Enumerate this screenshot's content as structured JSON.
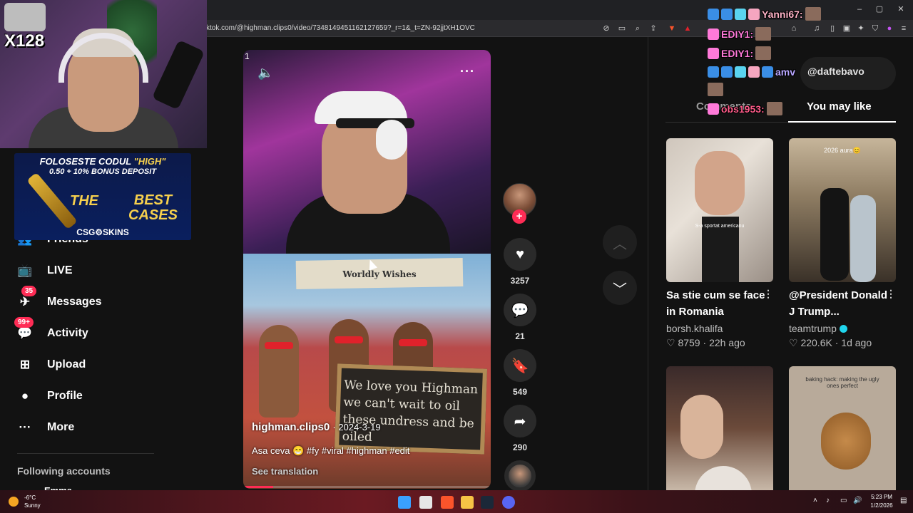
{
  "browser": {
    "url": "ktok.com/@highman.clips0/video/7348149451162127659?_r=1&_t=ZN-92jjtXH1OVC",
    "window_controls": [
      "–",
      "▢",
      "✕"
    ]
  },
  "stream_overlay": {
    "x_count": "X128",
    "chat": [
      {
        "user": "Yanni67:",
        "color": "#ffb3c7"
      },
      {
        "user": "EDIY1:",
        "color": "#ff7ad9"
      },
      {
        "user": "EDIY1:",
        "color": "#ff7ad9"
      },
      {
        "user": "amv",
        "color": "#b8a6ff"
      },
      {
        "user": "obs1953:",
        "color": "#ff5c8a"
      }
    ]
  },
  "ad": {
    "line1_prefix": "FOLOSESTE CODUL ",
    "line1_code": "\"HIGH\"",
    "line2": "0.50 + 10% BONUS DEPOSIT",
    "the": "THE",
    "best": "BEST",
    "cases": "CASES",
    "logo": "CSG⚙SKINS"
  },
  "sidebar": {
    "items": [
      {
        "label": "Friends",
        "icon": "friends-icon",
        "glyph": "👥"
      },
      {
        "label": "LIVE",
        "icon": "live-icon",
        "glyph": "📺"
      },
      {
        "label": "Messages",
        "icon": "messages-icon",
        "glyph": "✈",
        "badge": "35"
      },
      {
        "label": "Activity",
        "icon": "activity-icon",
        "glyph": "💬",
        "badge": "99+"
      },
      {
        "label": "Upload",
        "icon": "upload-icon",
        "glyph": "⊞"
      },
      {
        "label": "Profile",
        "icon": "profile-icon",
        "glyph": "●"
      },
      {
        "label": "More",
        "icon": "more-icon",
        "glyph": "···"
      }
    ],
    "following_heading": "Following accounts",
    "following_first": "Emma"
  },
  "video": {
    "corner_mark": "1",
    "banner_text": "Worldly Wishes",
    "sign_text": "We love you Highman we can't wait to oil these undress and be oiled",
    "author": "highman.clips0",
    "date": "· 2024-3-19",
    "caption": "Asa ceva 😁 #fy #viral #highman #edit",
    "translate": "See translation",
    "progress": 0.12
  },
  "actions": {
    "likes": "3257",
    "comments": "21",
    "saves": "549",
    "shares": "290"
  },
  "right_panel": {
    "search_text": "@daftebavo",
    "tabs": {
      "comments": "Comments",
      "you_may_like": "You may like"
    },
    "cards": [
      {
        "title": "Sa stie cum se face in Romania",
        "author": "borsh.khalifa",
        "verified": false,
        "likes": "8759",
        "age": "22h ago",
        "thumb_caption": "S-a sportat americanu"
      },
      {
        "title": "@President Donald J Trump...",
        "author": "teamtrump",
        "verified": true,
        "likes": "220.6K",
        "age": "1d ago",
        "thumb_caption": "2026 aura😊"
      },
      {
        "title": "",
        "author": "",
        "thumb_caption": ""
      },
      {
        "title": "",
        "author": "",
        "thumb_caption": "baking hack: making the ugly ones perfect"
      }
    ]
  },
  "taskbar": {
    "temp": "-6°C",
    "weather": "Sunny",
    "time": "5:23 PM",
    "date": "1/2/2026"
  }
}
